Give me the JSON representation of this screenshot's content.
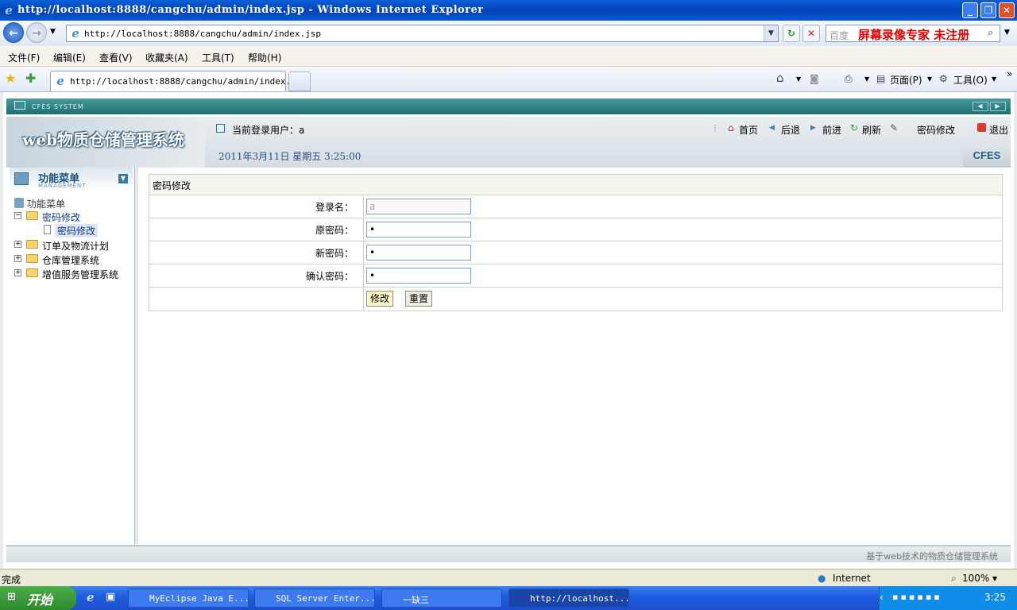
{
  "window": {
    "title": "http://localhost:8888/cangchu/admin/index.jsp - Windows Internet Explorer",
    "address": "http://localhost:8888/cangchu/admin/index.jsp",
    "search_placeholder": "百度",
    "watermark": "屏幕录像专家 未注册"
  },
  "menu": [
    "文件(F)",
    "编辑(E)",
    "查看(V)",
    "收藏夹(A)",
    "工具(T)",
    "帮助(H)"
  ],
  "tab": {
    "label": "http://localhost:8888/cangchu/admin/index..."
  },
  "commandbar": {
    "page": "页面(P)",
    "tools": "工具(O)"
  },
  "app": {
    "system_label": "CFES SYSTEM",
    "logo": "web物质仓储管理系统",
    "current_user_label": "当前登录用户：a",
    "datetime": "2011年3月11日  星期五  3:25:00",
    "brand": "CFES",
    "nav": {
      "home": "首页",
      "back": "后退",
      "forward": "前进",
      "refresh": "刷新",
      "change_password": "密码修改",
      "logout": "退出"
    },
    "sidebar": {
      "title": "功能菜单",
      "subtitle": "MANAGEMENT",
      "root": "功能菜单",
      "items": [
        {
          "label": "密码修改",
          "children": [
            "密码修改"
          ]
        },
        {
          "label": "订单及物流计划"
        },
        {
          "label": "仓库管理系统"
        },
        {
          "label": "增值服务管理系统"
        }
      ]
    },
    "form": {
      "title": "密码修改",
      "fields": [
        {
          "label": "登录名：",
          "value": "a"
        },
        {
          "label": "原密码：",
          "value": "•"
        },
        {
          "label": "新密码：",
          "value": "•"
        },
        {
          "label": "确认密码：",
          "value": "•"
        }
      ],
      "submit": "修改",
      "reset": "重置"
    },
    "footer": "基于web技术的物质仓储管理系统"
  },
  "statusbar": {
    "status": "完成",
    "zone": "Internet",
    "zoom": "100%"
  },
  "taskbar": {
    "start": "开始",
    "tasks": [
      "MyEclipse Java E...",
      "SQL Server Enter...",
      "一缺三",
      "http://localhost..."
    ],
    "clock": "3:25"
  }
}
